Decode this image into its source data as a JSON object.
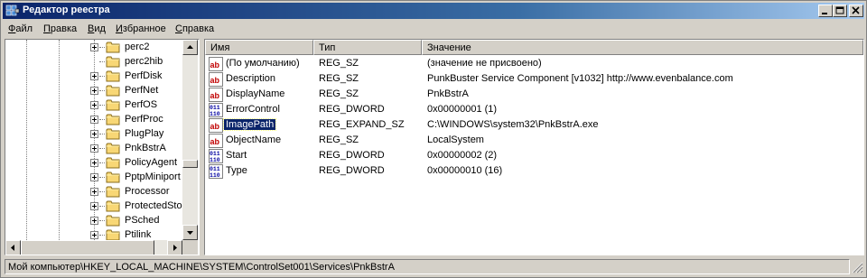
{
  "window": {
    "title": "Редактор реестра"
  },
  "menu": [
    {
      "accel": "Ф",
      "rest": "айл"
    },
    {
      "accel": "П",
      "rest": "равка"
    },
    {
      "accel": "В",
      "rest": "ид"
    },
    {
      "accel": "И",
      "rest": "збранное"
    },
    {
      "accel": "С",
      "rest": "правка"
    }
  ],
  "tree": {
    "items": [
      {
        "label": "perc2",
        "expandable": true
      },
      {
        "label": "perc2hib",
        "expandable": false
      },
      {
        "label": "PerfDisk",
        "expandable": true
      },
      {
        "label": "PerfNet",
        "expandable": true
      },
      {
        "label": "PerfOS",
        "expandable": true
      },
      {
        "label": "PerfProc",
        "expandable": true
      },
      {
        "label": "PlugPlay",
        "expandable": true
      },
      {
        "label": "PnkBstrA",
        "expandable": true
      },
      {
        "label": "PolicyAgent",
        "expandable": true
      },
      {
        "label": "PptpMiniport",
        "expandable": true
      },
      {
        "label": "Processor",
        "expandable": true
      },
      {
        "label": "ProtectedStor",
        "expandable": true
      },
      {
        "label": "PSched",
        "expandable": true
      },
      {
        "label": "Ptilink",
        "expandable": true
      }
    ]
  },
  "list": {
    "columns": {
      "name": "Имя",
      "type": "Тип",
      "data": "Значение"
    },
    "rows": [
      {
        "icon": "string-value-icon",
        "name": "(По умолчанию)",
        "type": "REG_SZ",
        "data": "(значение не присвоено)",
        "selected": false
      },
      {
        "icon": "string-value-icon",
        "name": "Description",
        "type": "REG_SZ",
        "data": "PunkBuster Service Component [v1032] http://www.evenbalance.com",
        "selected": false
      },
      {
        "icon": "string-value-icon",
        "name": "DisplayName",
        "type": "REG_SZ",
        "data": "PnkBstrA",
        "selected": false
      },
      {
        "icon": "dword-value-icon",
        "name": "ErrorControl",
        "type": "REG_DWORD",
        "data": "0x00000001 (1)",
        "selected": false
      },
      {
        "icon": "string-value-icon",
        "name": "ImagePath",
        "type": "REG_EXPAND_SZ",
        "data": "C:\\WINDOWS\\system32\\PnkBstrA.exe",
        "selected": true
      },
      {
        "icon": "string-value-icon",
        "name": "ObjectName",
        "type": "REG_SZ",
        "data": "LocalSystem",
        "selected": false
      },
      {
        "icon": "dword-value-icon",
        "name": "Start",
        "type": "REG_DWORD",
        "data": "0x00000002 (2)",
        "selected": false
      },
      {
        "icon": "dword-value-icon",
        "name": "Type",
        "type": "REG_DWORD",
        "data": "0x00000010 (16)",
        "selected": false
      }
    ]
  },
  "status": {
    "path": "Мой компьютер\\HKEY_LOCAL_MACHINE\\SYSTEM\\ControlSet001\\Services\\PnkBstrA"
  }
}
